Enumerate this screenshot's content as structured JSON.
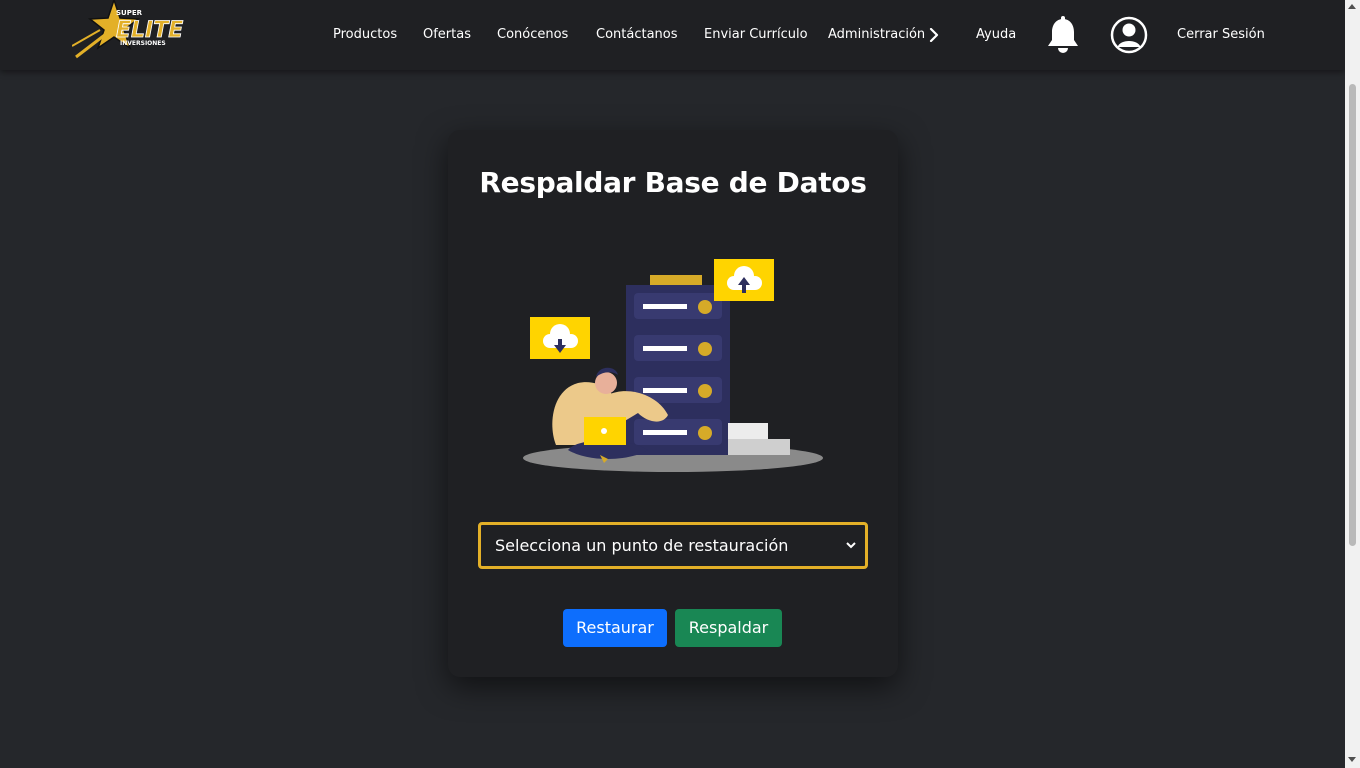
{
  "brand": {
    "logo_top": "SUPER",
    "logo_main": "ELITE",
    "logo_sub": "INVERSIONES",
    "accent": "#e3b028"
  },
  "nav": {
    "links": [
      "Productos",
      "Ofertas",
      "Conócenos",
      "Contáctanos",
      "Enviar Currículo",
      "Administración",
      "Ayuda"
    ],
    "logout": "Cerrar Sesión",
    "icons": [
      "chevron-right-icon",
      "bell-icon",
      "user-circle-icon"
    ]
  },
  "card": {
    "title": "Respaldar Base de Datos",
    "select": {
      "selected": "Selecciona un punto de restauración"
    },
    "buttons": {
      "restore": "Restaurar",
      "backup": "Respaldar"
    },
    "illustration_icons": [
      "cloud-download-icon",
      "cloud-upload-icon",
      "server-icon",
      "person-laptop-icon"
    ]
  },
  "colors": {
    "navbar_bg": "#1f2023",
    "page_bg": "#25272b",
    "card_bg": "#1f2023",
    "restore_button": "#0d6efd",
    "backup_button": "#198754",
    "select_border": "#e3b028"
  }
}
